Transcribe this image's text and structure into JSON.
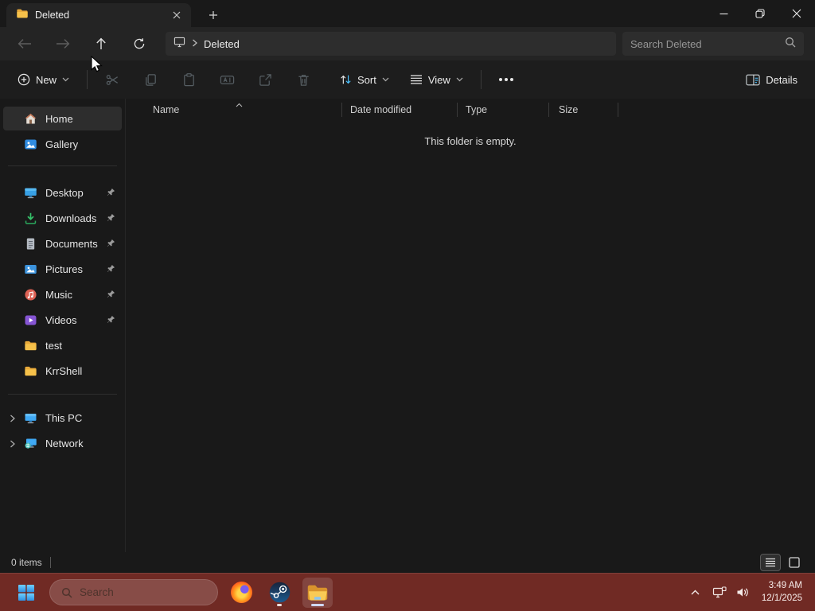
{
  "window": {
    "tab_title": "Deleted",
    "breadcrumb": "Deleted",
    "search_placeholder": "Search Deleted"
  },
  "toolbar": {
    "new_label": "New",
    "sort_label": "Sort",
    "view_label": "View",
    "details_label": "Details",
    "disabled_icons": [
      "cut-icon",
      "copy-icon",
      "paste-icon",
      "rename-icon",
      "share-icon",
      "delete-icon"
    ]
  },
  "columns": {
    "name": "Name",
    "date_modified": "Date modified",
    "type": "Type",
    "size": "Size",
    "sort": {
      "column": "Name",
      "direction": "ascending"
    }
  },
  "content": {
    "empty_message": "This folder is empty."
  },
  "sidebar": {
    "home": {
      "label": "Home",
      "selected": true
    },
    "gallery": {
      "label": "Gallery"
    },
    "pinned": [
      {
        "label": "Desktop",
        "icon": "desktop-icon",
        "pinned": true
      },
      {
        "label": "Downloads",
        "icon": "downloads-icon",
        "pinned": true
      },
      {
        "label": "Documents",
        "icon": "documents-icon",
        "pinned": true
      },
      {
        "label": "Pictures",
        "icon": "pictures-icon",
        "pinned": true
      },
      {
        "label": "Music",
        "icon": "music-icon",
        "pinned": true
      },
      {
        "label": "Videos",
        "icon": "videos-icon",
        "pinned": true
      }
    ],
    "folders": [
      {
        "label": "test",
        "icon": "folder-icon"
      },
      {
        "label": "KrrShell",
        "icon": "folder-icon"
      }
    ],
    "tree": [
      {
        "label": "This PC",
        "icon": "this-pc-icon"
      },
      {
        "label": "Network",
        "icon": "network-icon"
      }
    ]
  },
  "statusbar": {
    "count": "0 items"
  },
  "taskbar": {
    "search_placeholder": "Search",
    "apps": [
      {
        "name": "firefox",
        "running": false,
        "active": false
      },
      {
        "name": "steam",
        "running": true,
        "active": false
      },
      {
        "name": "file-explorer",
        "running": true,
        "active": true
      }
    ],
    "tray": {
      "time": "3:49 AM",
      "date": "12/1/2025"
    }
  },
  "colors": {
    "taskbar_bg": "#702a24",
    "accent_blue": "#4cc2ff",
    "folder_yellow": "#f6c14a",
    "selection_bg": "#2d2d2d",
    "window_bg": "#191919"
  }
}
